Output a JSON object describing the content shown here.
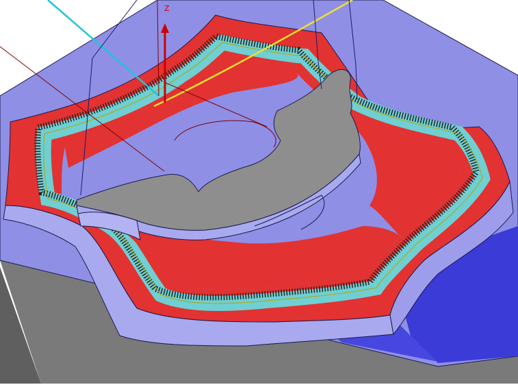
{
  "viewport": {
    "axis": {
      "z_label": "Z"
    },
    "colors": {
      "background": "#ffffff",
      "stock_top": "#8f8fe6",
      "stock_side_dark": "#3b3bd8",
      "stock_base": "#7c7c7c",
      "stock_base_dark": "#5e5e5e",
      "machined_region": "#e23232",
      "wall_side": "#a9a9f0",
      "toolpath_band": "#6fcfd2",
      "part_grey": "#8e8e8e",
      "toolpath_line": "#e3d23a",
      "cyan_line": "#1fc5d6",
      "axis_red": "#cc0000",
      "outline_dark": "#1a1a4a"
    }
  }
}
